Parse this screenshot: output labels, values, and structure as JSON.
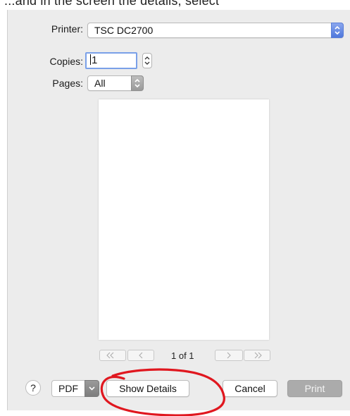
{
  "background_text": "...and in the screen the details, select",
  "printer": {
    "label": "Printer:",
    "value": "TSC DC2700"
  },
  "copies": {
    "label": "Copies:",
    "value": "1"
  },
  "pages": {
    "label": "Pages:",
    "value": "All"
  },
  "preview": {
    "page_indicator": "1 of 1"
  },
  "footer": {
    "help_label": "?",
    "pdf_label": "PDF",
    "show_details_label": "Show Details",
    "cancel_label": "Cancel",
    "print_label": "Print"
  },
  "colors": {
    "dialog_bg": "#ececec",
    "accent_blue": "#5b7fd8",
    "annotation_red": "#e0171f"
  }
}
